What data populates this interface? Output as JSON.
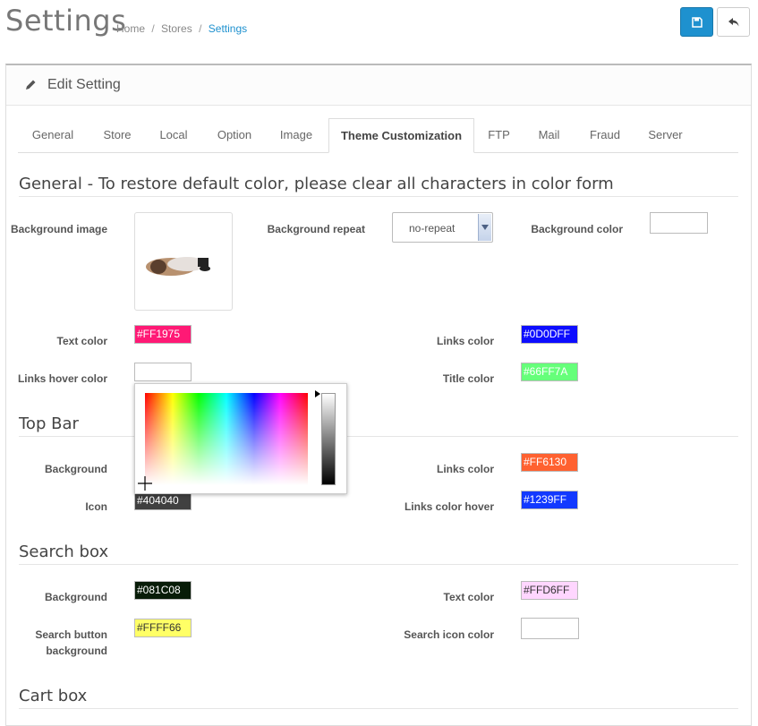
{
  "page": {
    "title": "Settings",
    "breadcrumb": [
      "Home",
      "Stores",
      "Settings"
    ]
  },
  "panel": {
    "title": "Edit Setting"
  },
  "tabs": [
    "General",
    "Store",
    "Local",
    "Option",
    "Image",
    "Theme Customization",
    "FTP",
    "Mail",
    "Fraud",
    "Server"
  ],
  "active_tab": "Theme Customization",
  "general": {
    "heading": "General - To restore default color, please clear all characters in color form",
    "background_image_label": "Background image",
    "background_repeat_label": "Background repeat",
    "background_repeat_value": "no-repeat",
    "background_color_label": "Background color",
    "background_color_value": "",
    "text_color_label": "Text color",
    "text_color_value": "#FF1975",
    "links_color_label": "Links color",
    "links_color_value": "#0D0DFF",
    "links_hover_label": "Links hover color",
    "links_hover_value": "",
    "title_color_label": "Title color",
    "title_color_value": "#66FF7A"
  },
  "topbar": {
    "heading": "Top Bar",
    "background_label": "Background",
    "links_color_label": "Links color",
    "links_color_value": "#FF6130",
    "icon_label": "Icon",
    "icon_value": "#404040",
    "links_hover_label": "Links color hover",
    "links_hover_value": "#1239FF"
  },
  "searchbox": {
    "heading": "Search box",
    "background_label": "Background",
    "background_value": "#081C08",
    "text_color_label": "Text color",
    "text_color_value": "#FFD6FF",
    "button_bg_label_1": "Search button",
    "button_bg_label_2": "background",
    "button_bg_value": "#FFFF66",
    "icon_color_label": "Search icon color",
    "icon_color_value": ""
  },
  "cartbox": {
    "heading": "Cart box"
  },
  "icons": [
    "save-icon",
    "reply-icon",
    "pencil-icon",
    "chevron-down-icon"
  ],
  "colors": {
    "primary": "#1e91cf",
    "breadcrumb_active": "#1e91cf"
  }
}
